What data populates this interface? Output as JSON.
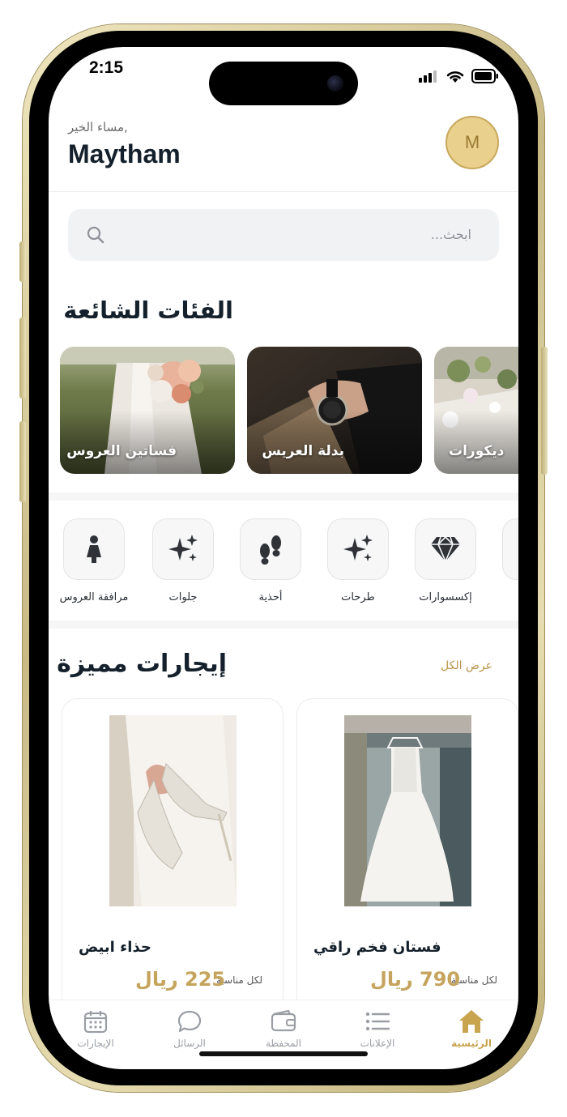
{
  "status_bar": {
    "time": "2:15"
  },
  "header": {
    "greeting": "مساء الخير,",
    "user_name": "Maytham",
    "avatar_initial": "M"
  },
  "search": {
    "placeholder": "ابحث..."
  },
  "categories": {
    "title": "الفئات الشائعة",
    "items": [
      {
        "label": "فساتين العروس",
        "icon": "bride-bouquet-photo"
      },
      {
        "label": "بدلة العريس",
        "icon": "groom-watch-photo"
      },
      {
        "label": "ديكورات",
        "icon": "table-decor-photo"
      }
    ]
  },
  "quick_links": [
    {
      "label": "مرافقة العروس",
      "icon": "person-dress-icon"
    },
    {
      "label": "جلوات",
      "icon": "sparkles-icon"
    },
    {
      "label": "أحذية",
      "icon": "footprints-icon"
    },
    {
      "label": "طرحات",
      "icon": "sparkles-icon"
    },
    {
      "label": "إكسسوارات",
      "icon": "diamond-icon"
    }
  ],
  "featured": {
    "title": "إيجارات مميزة",
    "view_all": "عرض الكل",
    "products": [
      {
        "name": "حذاء ابيض",
        "per": "لكل مناسبة",
        "price": "225 ريال"
      },
      {
        "name": "فستان فخم راقي",
        "per": "لكل مناسبة",
        "price": "790 ريال"
      }
    ]
  },
  "tabbar": {
    "items": [
      {
        "label": "الإيجارات",
        "icon": "calendar-icon",
        "active": false
      },
      {
        "label": "الرسائل",
        "icon": "chat-icon",
        "active": false
      },
      {
        "label": "المحفظة",
        "icon": "wallet-icon",
        "active": false
      },
      {
        "label": "الإعلانات",
        "icon": "list-icon",
        "active": false
      },
      {
        "label": "الرئيسية",
        "icon": "home-icon",
        "active": true
      }
    ]
  },
  "colors": {
    "accent": "#c9a44f",
    "avatar_bg": "#ead08d",
    "text_dark": "#14202b"
  }
}
